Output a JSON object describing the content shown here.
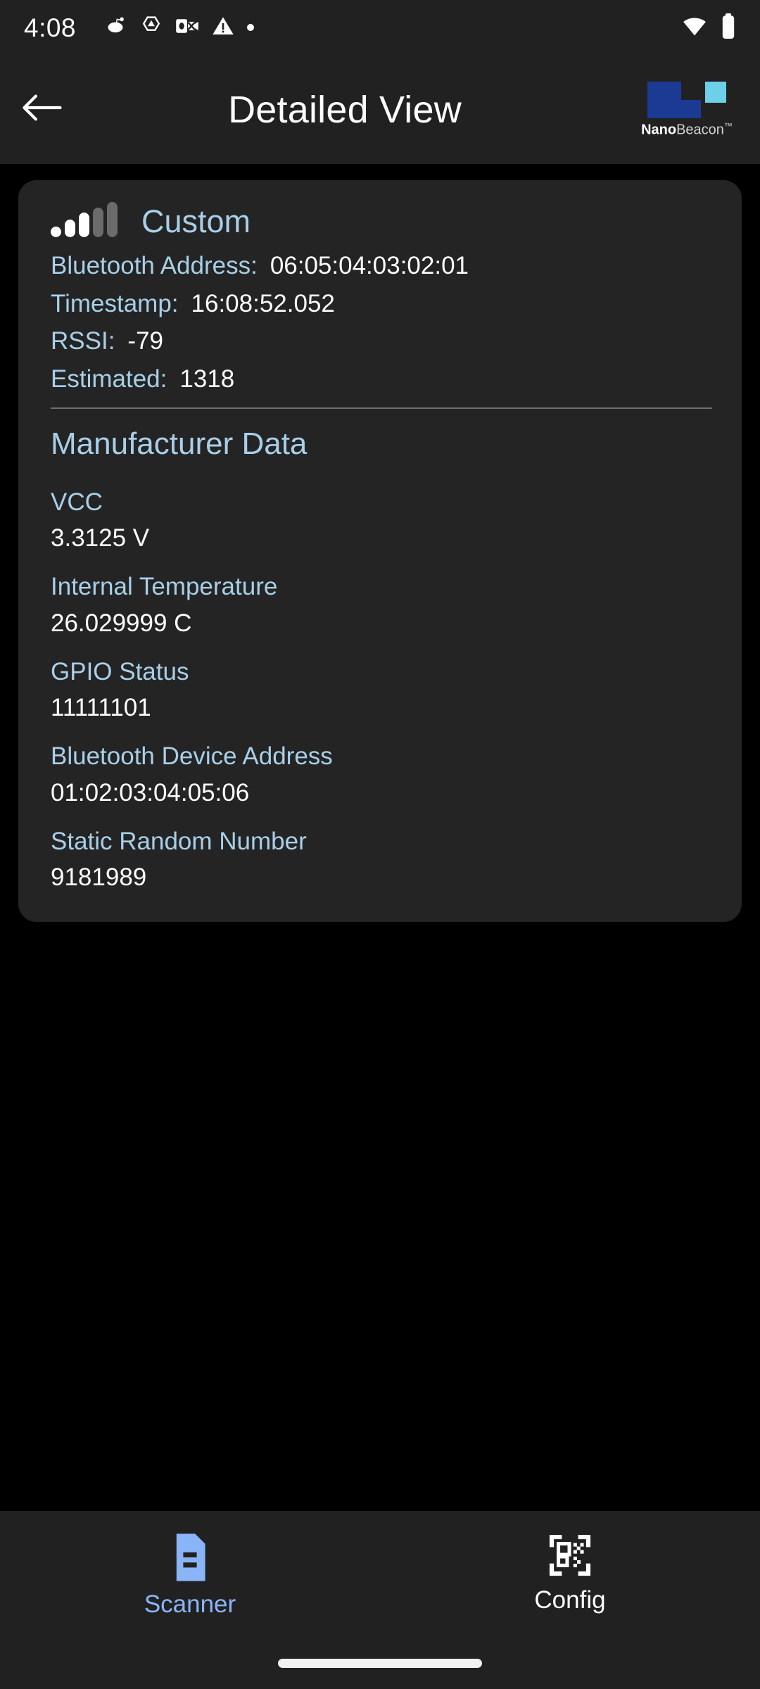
{
  "status_bar": {
    "clock": "4:08",
    "left_icons": [
      "reddit-icon",
      "drive-icon",
      "outlook-icon",
      "warning-icon",
      "dot-icon"
    ],
    "right_icons": [
      "wifi-icon",
      "battery-icon"
    ]
  },
  "app_bar": {
    "back_icon": "back-arrow-icon",
    "title": "Detailed View",
    "logo": {
      "name_bold": "Nano",
      "name_light": "Beacon",
      "trademark": "™",
      "color_dark_blue": "#1b3a93",
      "color_cyan": "#6cd0e8"
    }
  },
  "card": {
    "signal_icon": "signal-strength-icon",
    "signal_bars_active": 3,
    "signal_bars_total": 5,
    "title": "Custom",
    "meta": [
      {
        "label": "Bluetooth Address:",
        "value": "06:05:04:03:02:01"
      },
      {
        "label": "Timestamp:",
        "value": "16:08:52.052"
      },
      {
        "label": "RSSI:",
        "value": "-79"
      },
      {
        "label": "Estimated:",
        "value": "1318"
      }
    ],
    "section_title": "Manufacturer Data",
    "fields": [
      {
        "label": "VCC",
        "value": "3.3125  V"
      },
      {
        "label": "Internal Temperature",
        "value": "26.029999  C"
      },
      {
        "label": "GPIO Status",
        "value": "11111101"
      },
      {
        "label": "Bluetooth Device Address",
        "value": "01:02:03:04:05:06"
      },
      {
        "label": "Static Random Number",
        "value": "9181989"
      }
    ]
  },
  "bottom_nav": {
    "items": [
      {
        "label": "Scanner",
        "icon": "document-scanner-icon",
        "active": true
      },
      {
        "label": "Config",
        "icon": "qr-code-icon",
        "active": false
      }
    ],
    "active_color": "#8ab4f8",
    "inactive_color": "#ffffff"
  },
  "theme": {
    "background": "#000000",
    "surface": "#212121",
    "card": "#242424",
    "accent_text": "#a8cfe8",
    "primary_text": "#ffffff"
  }
}
